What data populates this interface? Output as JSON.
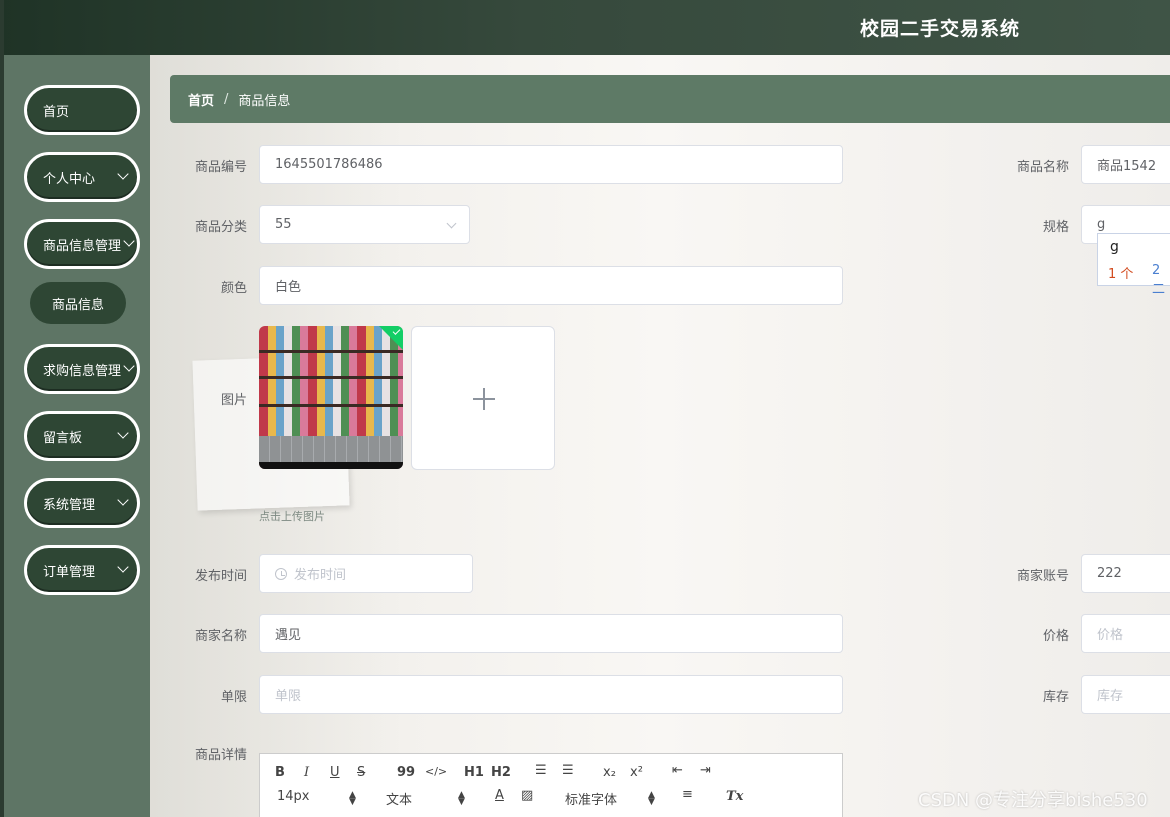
{
  "header": {
    "title": "校园二手交易系统"
  },
  "sidebar": {
    "items": [
      {
        "label": "首页"
      },
      {
        "label": "个人中心"
      },
      {
        "label": "商品信息管理"
      },
      {
        "label": "求购信息管理"
      },
      {
        "label": "留言板"
      },
      {
        "label": "系统管理"
      },
      {
        "label": "订单管理"
      }
    ],
    "submenu": {
      "label": "商品信息"
    }
  },
  "breadcrumb": {
    "home": "首页",
    "separator": "/",
    "current": "商品信息"
  },
  "form": {
    "goods_no": {
      "label": "商品编号",
      "value": "1645501786486"
    },
    "goods_name": {
      "label": "商品名称",
      "value": "商品1542"
    },
    "category": {
      "label": "商品分类",
      "value": "55"
    },
    "spec": {
      "label": "规格",
      "value": "g"
    },
    "color": {
      "label": "颜色",
      "value": "白色"
    },
    "image": {
      "label": "图片",
      "tip": "点击上传图片"
    },
    "publish_time": {
      "label": "发布时间",
      "placeholder": "发布时间"
    },
    "merchant_account": {
      "label": "商家账号",
      "value": "222"
    },
    "merchant_name": {
      "label": "商家名称",
      "value": "遇见"
    },
    "price": {
      "label": "价格",
      "placeholder": "价格"
    },
    "limit": {
      "label": "单限",
      "placeholder": "单限"
    },
    "stock": {
      "label": "库存",
      "placeholder": "库存"
    },
    "details": {
      "label": "商品详情"
    }
  },
  "ime": {
    "composition": "g",
    "candidates": [
      "1 个",
      "2 二"
    ]
  },
  "editor": {
    "toolbar": {
      "bold": "B",
      "italic": "I",
      "underline": "U",
      "strike": "S",
      "quote": "99",
      "code": "</>",
      "h1": "H1",
      "h2": "H2",
      "sub": "x₂",
      "sup": "x²",
      "size": "14px",
      "header": "文本",
      "font": "标准字体",
      "clear": "Tx"
    }
  },
  "watermark": "CSDN @专注分享bishe530",
  "colors": {
    "header_bg": "#2f4437",
    "sidebar_bg": "#5e7565",
    "accent": "#2e4634",
    "success": "#13ce66"
  }
}
